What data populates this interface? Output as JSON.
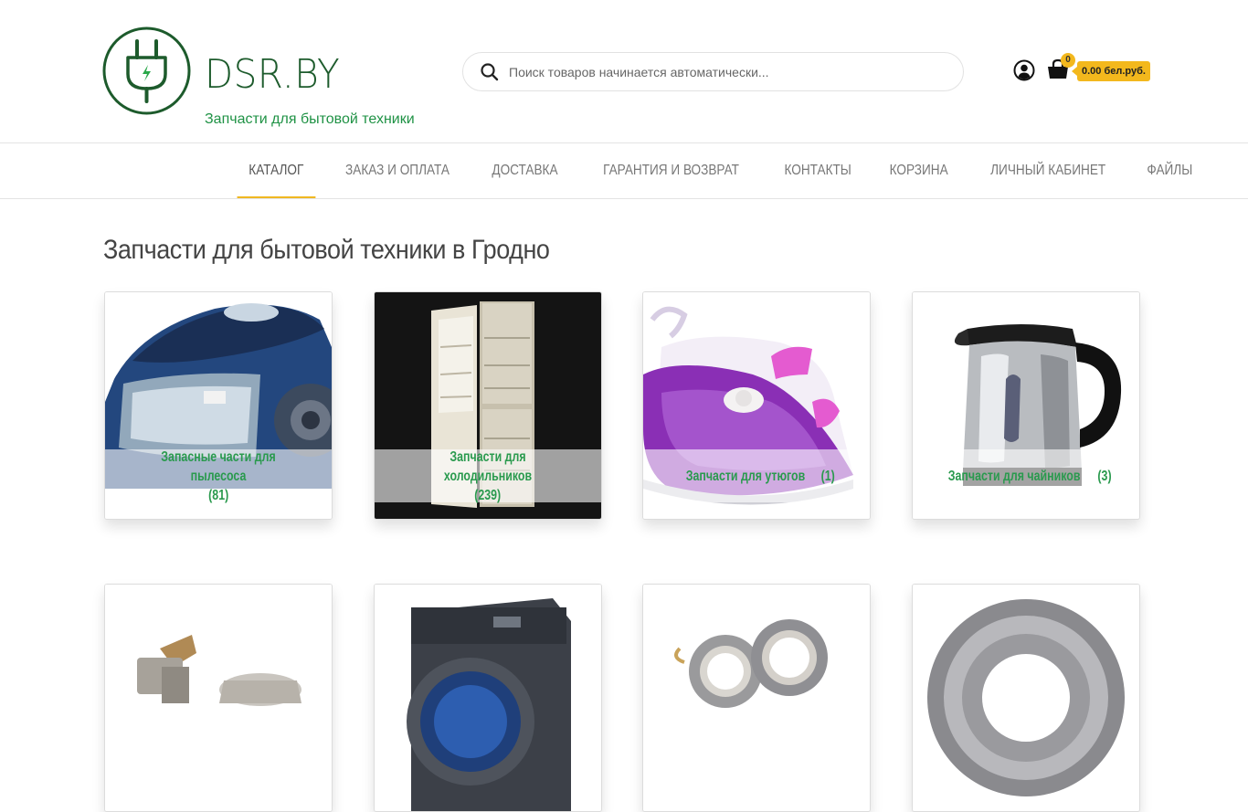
{
  "brand": {
    "name": "DSR.BY",
    "tagline": "Запчасти для бытовой техники"
  },
  "search": {
    "placeholder": "Поиск товаров начинается автоматически..."
  },
  "cart": {
    "count": "0",
    "total": "0.00 бел.руб."
  },
  "nav": {
    "items": [
      {
        "label": "Каталог",
        "active": true
      },
      {
        "label": "Заказ и оплата"
      },
      {
        "label": "Доставка"
      },
      {
        "label": "Гарантия и возврат"
      },
      {
        "label": "Контакты"
      },
      {
        "label": "Корзина"
      },
      {
        "label": "Личный кабинет"
      },
      {
        "label": "Файлы"
      }
    ]
  },
  "page": {
    "title": "Запчасти для бытовой техники в Гродно"
  },
  "categories": [
    {
      "name": "Запасные части для пылесоса",
      "count": "(81)"
    },
    {
      "name": "Запчасти для холодильников",
      "count": "(239)"
    },
    {
      "name": "Запчасти для утюгов",
      "count": "(1)"
    },
    {
      "name": "Запчасти для чайников",
      "count": "(3)"
    }
  ],
  "colors": {
    "brand_green": "#1d5b2c",
    "accent_green": "#2a9a4e",
    "accent_yellow": "#f3b81d"
  }
}
